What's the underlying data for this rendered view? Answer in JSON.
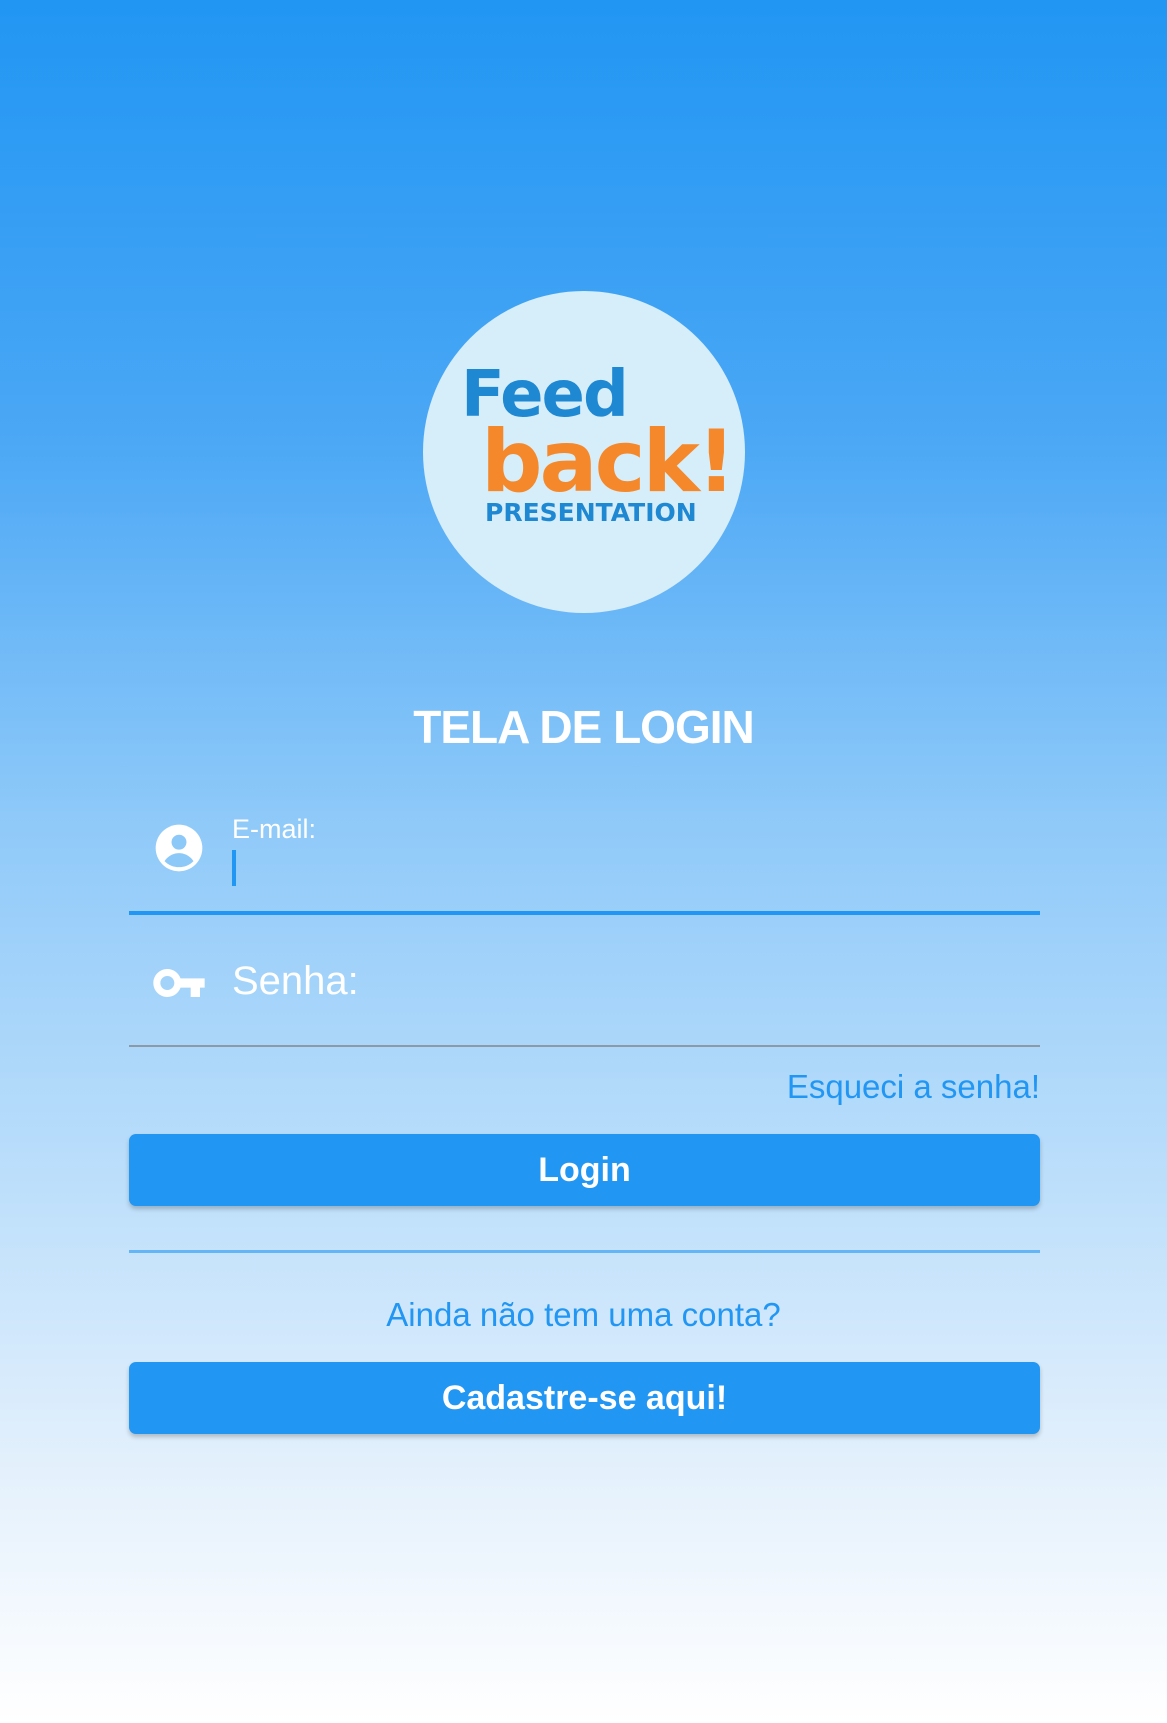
{
  "logo": {
    "word1": "Feed",
    "word2": "back!",
    "word3": "PRESENTATION",
    "circle_color": "#d6edfa",
    "color_feed": "#1e88d2",
    "color_back": "#f5882a"
  },
  "title": "TELA DE LOGIN",
  "email": {
    "label": "E-mail:",
    "value": "",
    "icon": "account-circle-icon"
  },
  "password": {
    "placeholder": "Senha:",
    "value": "",
    "icon": "key-icon"
  },
  "forgot_password": "Esqueci a senha!",
  "login_button": "Login",
  "no_account_text": "Ainda não tem uma conta?",
  "signup_button": "Cadastre-se aqui!",
  "colors": {
    "primary": "#2196F3",
    "text_on_primary": "#ffffff"
  }
}
